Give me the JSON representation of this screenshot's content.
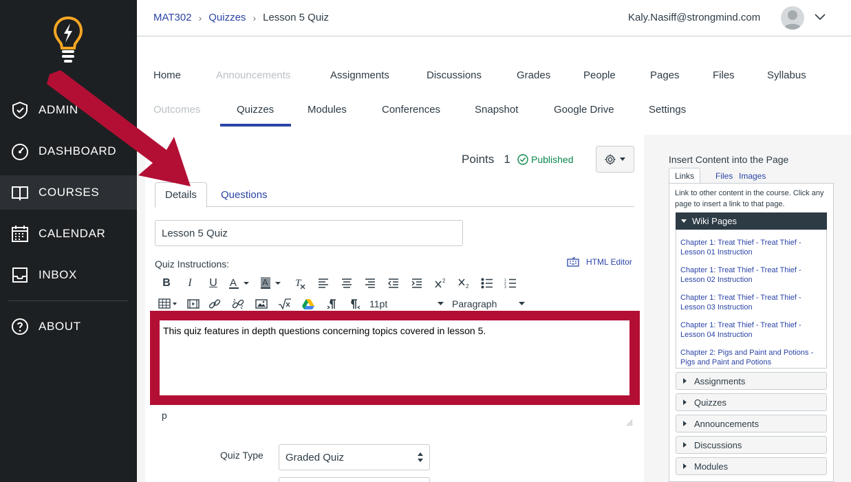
{
  "gnav": {
    "items": [
      {
        "label": "ADMIN",
        "icon": "shield-icon"
      },
      {
        "label": "DASHBOARD",
        "icon": "dashboard-icon"
      },
      {
        "label": "COURSES",
        "icon": "book-icon"
      },
      {
        "label": "CALENDAR",
        "icon": "calendar-icon"
      },
      {
        "label": "INBOX",
        "icon": "inbox-icon"
      },
      {
        "label": "ABOUT",
        "icon": "help-icon"
      }
    ],
    "active": "COURSES"
  },
  "breadcrumb": {
    "course": "MAT302",
    "section": "Quizzes",
    "current": "Lesson 5 Quiz"
  },
  "user": {
    "email": "Kaly.Nasiff@strongmind.com"
  },
  "course_nav": {
    "row1": [
      "Home",
      "Announcements",
      "Assignments",
      "Discussions",
      "Grades",
      "People",
      "Pages",
      "Files",
      "Syllabus"
    ],
    "row2": [
      "Outcomes",
      "Quizzes",
      "Modules",
      "Conferences",
      "Snapshot",
      "Google Drive",
      "Settings"
    ],
    "active": "Quizzes"
  },
  "quiz": {
    "points_label": "Points",
    "points_value": "1",
    "status": "Published",
    "tabs": [
      "Details",
      "Questions"
    ],
    "title": "Lesson 5 Quiz",
    "instructions_label": "Quiz Instructions:",
    "html_editor_label": "HTML Editor",
    "font_size": "11pt",
    "block_format": "Paragraph",
    "instructions_text": "This quiz features in depth questions concerning topics covered in lesson 5.",
    "path": "p",
    "quiz_type_label": "Quiz Type",
    "quiz_type_value": "Graded Quiz"
  },
  "sidebar": {
    "title": "Insert Content into the Page",
    "tabs": [
      "Links",
      "Files",
      "Images"
    ],
    "help": "Link to other content in the course. Click any page to insert a link to that page.",
    "wiki_header": "Wiki Pages",
    "wiki_pages": [
      "Chapter 1: Treat Thief - Treat Thief - Lesson 01 Instruction",
      "Chapter 1: Treat Thief - Treat Thief - Lesson 02 Instruction",
      "Chapter 1: Treat Thief - Treat Thief - Lesson 03 Instruction",
      "Chapter 1: Treat Thief - Treat Thief - Lesson 04 Instruction",
      "Chapter 2: Pigs and Paint and Potions - Pigs and Paint and Potions"
    ],
    "sections": [
      "Assignments",
      "Quizzes",
      "Announcements",
      "Discussions",
      "Modules"
    ]
  },
  "colors": {
    "nav_bg": "#1d2022",
    "link": "#2b44a6",
    "annotation": "#b30f35",
    "published": "#0b874b",
    "logo": "#f5a623"
  }
}
